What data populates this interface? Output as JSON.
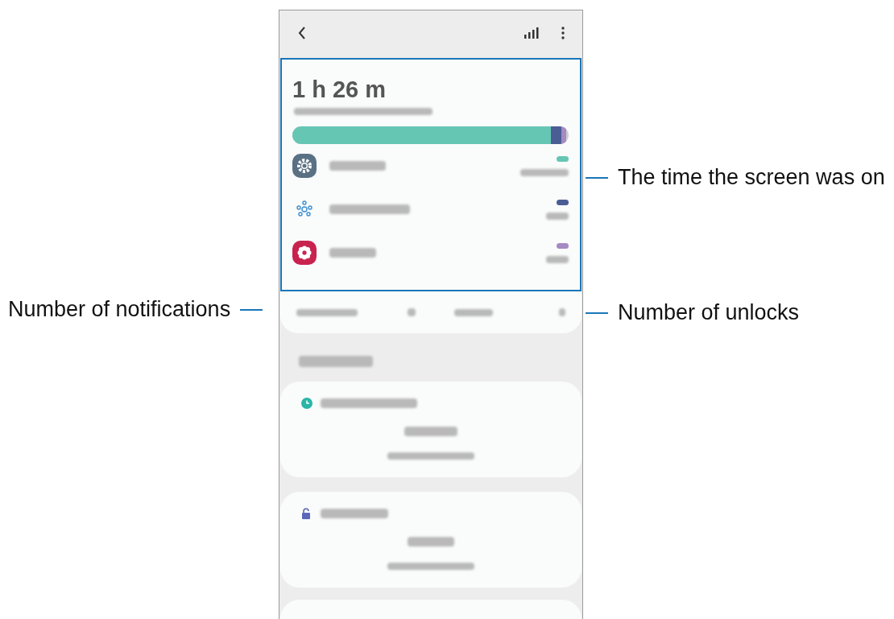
{
  "screen": {
    "total_time": "1 h 26 m",
    "usage_bar": {
      "level": 0.935,
      "segments": [
        {
          "color": "#66c6b4"
        },
        {
          "color": "#4a5d94"
        },
        {
          "color": "#a58ac4"
        }
      ]
    },
    "apps": [
      {
        "color": "#66c6b4"
      },
      {
        "color": "#4a5d94"
      },
      {
        "color": "#a58ac4"
      }
    ]
  },
  "callouts": [
    {
      "text": "The time the screen was on",
      "kind": "right"
    },
    {
      "text": "Number of notifications",
      "kind": "left"
    },
    {
      "text": "Number of unlocks",
      "kind": "right"
    }
  ]
}
